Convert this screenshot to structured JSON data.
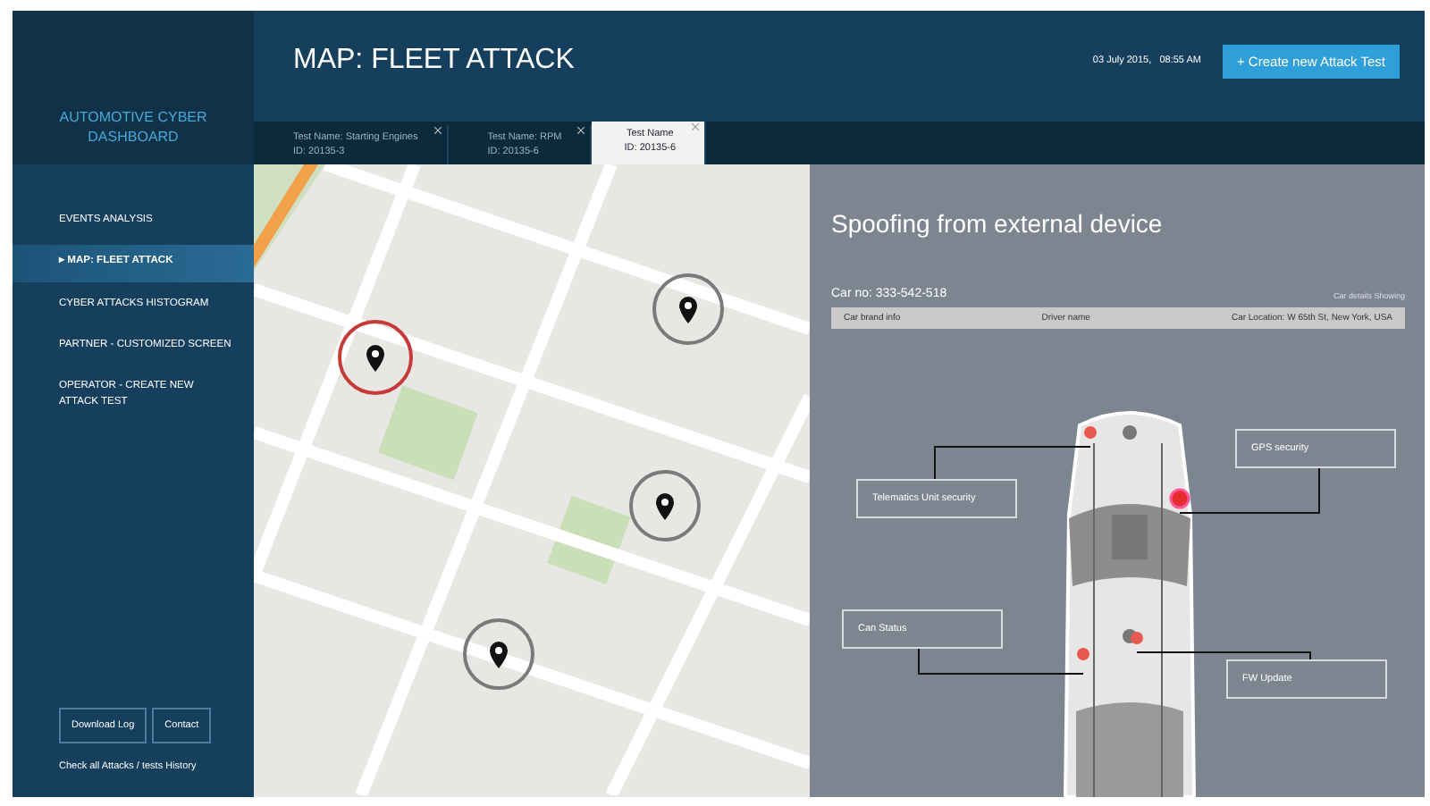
{
  "sidebar": {
    "logo": "AUTOMOTIVE CYBER DASHBOARD",
    "items": [
      {
        "label": "EVENTS ANALYSIS",
        "selected": false
      },
      {
        "label": "▸ MAP: FLEET ATTACK",
        "selected": true
      },
      {
        "label": "CYBER ATTACKS HISTOGRAM",
        "selected": false
      },
      {
        "label": "PARTNER - CUSTOMIZED SCREEN",
        "selected": false
      },
      {
        "label": "OPERATOR - CREATE NEW ATTACK TEST",
        "selected": false
      }
    ],
    "buttons": [
      "Download Log",
      "Contact"
    ],
    "footer_link": "Check all Attacks / tests History"
  },
  "header": {
    "title": "MAP: FLEET ATTACK",
    "datetime": "03 July 2015,   08:55 AM",
    "create_button": "+ Create new Attack Test"
  },
  "tabs": [
    {
      "name": "Test Name: Starting Engines",
      "id": "ID: 20135-3",
      "selected": false
    },
    {
      "name": "Test Name: RPM",
      "id": "ID: 20135-6",
      "selected": false
    },
    {
      "name": "Test Name",
      "id": "ID: 20135-6",
      "selected": true
    }
  ],
  "map": {
    "markers": [
      {
        "alert": true
      },
      {
        "alert": false
      },
      {
        "alert": false
      },
      {
        "alert": false
      }
    ]
  },
  "detail": {
    "title": "Spoofing from external device",
    "car_no": "Car no: 333-542-518",
    "details_link": "Car details Showing",
    "info": [
      "Car brand info",
      "Driver name",
      "Car Location: W 65th St, New York, USA"
    ],
    "callouts": [
      "Telematics Unit security",
      "GPS security",
      "Can Status",
      "FW Update"
    ]
  }
}
